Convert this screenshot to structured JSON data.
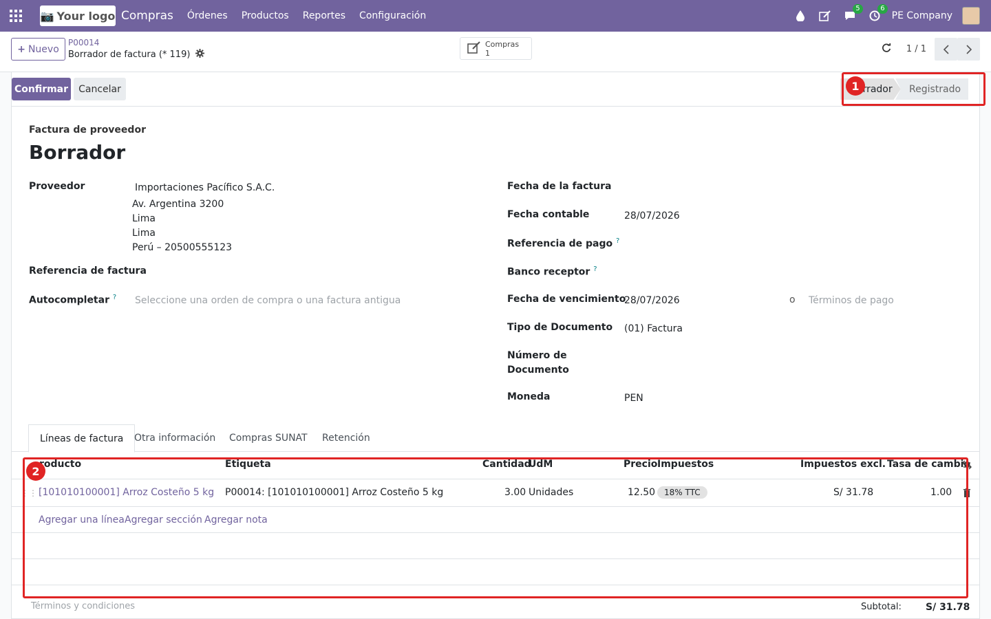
{
  "topbar": {
    "logo": "Your logo",
    "app_name": "Compras",
    "menu": [
      "Órdenes",
      "Productos",
      "Reportes",
      "Configuración"
    ],
    "chat_count": "5",
    "activity_count": "6",
    "company": "PE Company"
  },
  "control": {
    "new_label": "Nuevo",
    "breadcrumb_parent": "P00014",
    "breadcrumb_current": "Borrador de factura (* 119)",
    "smart_label": "Compras",
    "smart_count": "1",
    "pager": "1 / 1"
  },
  "status": {
    "confirm_label": "Confirmar",
    "cancel_label": "Cancelar",
    "stages": [
      "Borrador",
      "Registrado"
    ],
    "active_stage_shown": "orrador"
  },
  "annotations": [
    "1",
    "2"
  ],
  "form": {
    "doc_type": "Factura de proveedor",
    "title": "Borrador",
    "vendor_label": "Proveedor",
    "vendor_name": "Importaciones Pacífico S.A.C.",
    "vendor_address": [
      "Av. Argentina 3200",
      "Lima",
      "Lima",
      "Perú – 20500555123"
    ],
    "ref_label": "Referencia de factura",
    "autocomplete_label": "Autocompletar",
    "autocomplete_placeholder": "Seleccione una orden de compra o una factura antigua",
    "invoice_date_label": "Fecha de la factura",
    "accounting_date_label": "Fecha contable",
    "accounting_date": "28/07/2026",
    "payment_ref_label": "Referencia de pago",
    "bank_label": "Banco receptor",
    "due_date_label": "Fecha de vencimiento",
    "due_date": "28/07/2026",
    "or_label": "o",
    "terms_placeholder": "Términos de pago",
    "doc_type_label": "Tipo de Documento",
    "doc_type_value": "(01) Factura",
    "doc_number_label_1": "Número de",
    "doc_number_label_2": "Documento",
    "currency_label": "Moneda",
    "currency": "PEN",
    "help": "?"
  },
  "tabs": [
    "Líneas de factura",
    "Otra información",
    "Compras SUNAT",
    "Retención"
  ],
  "table": {
    "headers": [
      "roducto",
      "Etiqueta",
      "Cantidad",
      "UdM",
      "Precio",
      "Impuestos",
      "Impuestos excl.",
      "Tasa de cambio"
    ],
    "rows": [
      {
        "product": "[101010100001] Arroz Costeño 5 kg",
        "label": "P00014: [101010100001] Arroz Costeño 5 kg",
        "qty": "3.00",
        "uom": "Unidades",
        "price": "12.50",
        "tax": "18% TTC",
        "subtotal": "S/ 31.78",
        "rate": "1.00"
      }
    ],
    "add_line": "Agregar una línea",
    "add_section": "Agregar sección",
    "add_note": "Agregar nota"
  },
  "footer": {
    "terms_placeholder": "Términos y condiciones",
    "subtotal_label": "Subtotal:",
    "subtotal_value": "S/ 31.78"
  },
  "colors": {
    "primary": "#71639e",
    "annotation": "#e02424"
  }
}
